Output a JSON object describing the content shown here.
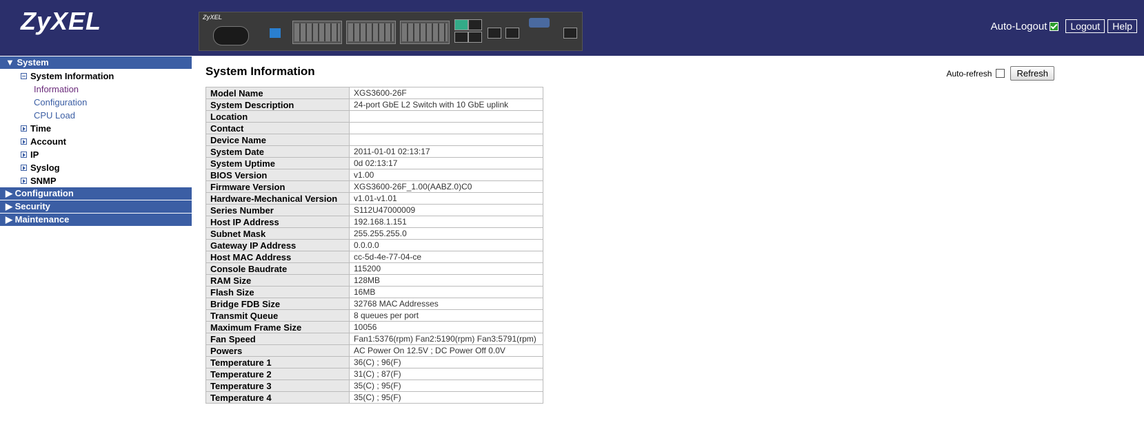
{
  "header": {
    "logo": "ZyXEL",
    "device_label": "ZyXEL",
    "auto_logout_label": "Auto-Logout",
    "logout_label": "Logout",
    "help_label": "Help"
  },
  "sidebar": {
    "system": "▼ System",
    "system_information": "System Information",
    "leaves": [
      "Information",
      "Configuration",
      "CPU Load"
    ],
    "sub_items": [
      "Time",
      "Account",
      "IP",
      "Syslog",
      "SNMP"
    ],
    "sections": [
      "▶ Configuration",
      "▶ Security",
      "▶ Maintenance"
    ]
  },
  "main": {
    "title": "System Information",
    "auto_refresh_label": "Auto-refresh",
    "refresh_label": "Refresh",
    "rows": [
      {
        "k": "Model Name",
        "v": "XGS3600-26F"
      },
      {
        "k": "System Description",
        "v": "24-port GbE L2 Switch with 10 GbE uplink"
      },
      {
        "k": "Location",
        "v": ""
      },
      {
        "k": "Contact",
        "v": ""
      },
      {
        "k": "Device Name",
        "v": ""
      },
      {
        "k": "System Date",
        "v": "2011-01-01 02:13:17"
      },
      {
        "k": "System Uptime",
        "v": "0d 02:13:17"
      },
      {
        "k": "BIOS Version",
        "v": "v1.00"
      },
      {
        "k": "Firmware Version",
        "v": "XGS3600-26F_1.00(AABZ.0)C0"
      },
      {
        "k": "Hardware-Mechanical Version",
        "v": "v1.01-v1.01"
      },
      {
        "k": "Series Number",
        "v": "S112U47000009"
      },
      {
        "k": "Host IP Address",
        "v": "192.168.1.151"
      },
      {
        "k": "Subnet Mask",
        "v": "255.255.255.0"
      },
      {
        "k": "Gateway IP Address",
        "v": "0.0.0.0"
      },
      {
        "k": "Host MAC Address",
        "v": "cc-5d-4e-77-04-ce"
      },
      {
        "k": "Console Baudrate",
        "v": "115200"
      },
      {
        "k": "RAM Size",
        "v": "128MB"
      },
      {
        "k": "Flash Size",
        "v": "16MB"
      },
      {
        "k": "Bridge FDB Size",
        "v": "32768 MAC Addresses"
      },
      {
        "k": "Transmit Queue",
        "v": "8 queues per port"
      },
      {
        "k": "Maximum Frame Size",
        "v": "10056"
      },
      {
        "k": "Fan Speed",
        "v": "Fan1:5376(rpm) Fan2:5190(rpm) Fan3:5791(rpm)"
      },
      {
        "k": "Powers",
        "v": "AC Power On 12.5V ; DC Power Off 0.0V"
      },
      {
        "k": "Temperature 1",
        "v": "36(C) ; 96(F)"
      },
      {
        "k": "Temperature 2",
        "v": "31(C) ; 87(F)"
      },
      {
        "k": "Temperature 3",
        "v": "35(C) ; 95(F)"
      },
      {
        "k": "Temperature 4",
        "v": "35(C) ; 95(F)"
      }
    ]
  },
  "colors": {
    "header_bg": "#2b2f6b",
    "section_bg": "#3b5ea4",
    "active_link": "#6b2b7b"
  }
}
